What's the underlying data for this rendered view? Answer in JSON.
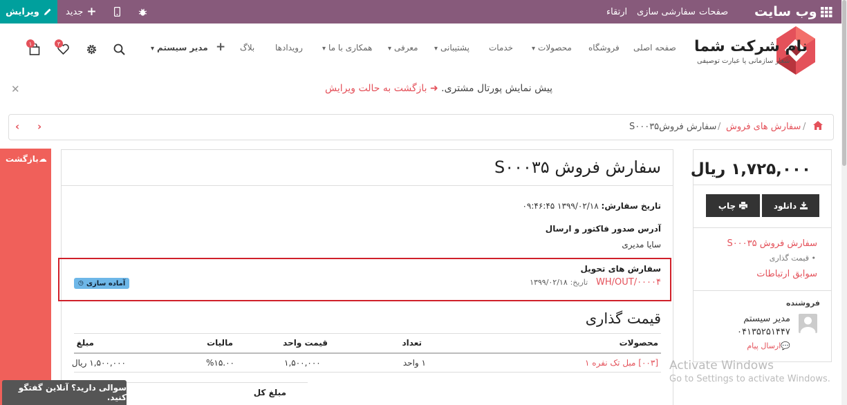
{
  "admin_bar": {
    "edit_label": "ویرایش",
    "new_label": "جدید",
    "site_title": "وب سایت",
    "pages": "صفحات",
    "customize": "سفارشی سازی",
    "upgrade": "ارتقاء"
  },
  "navbar": {
    "logo_name": "نام شرکت شما",
    "logo_slogan": "شعار سازمانی یا عبارت توصیفی",
    "links": [
      "صفحه اصلی",
      "فروشگاه",
      "محصولات",
      "خدمات",
      "پشتیبانی",
      "معرفی",
      "همکاری با ما",
      "رویدادها",
      "بلاگ"
    ],
    "user_menu": "مدیر سیستم",
    "wishlist_count": "۳",
    "cart_count": "۱"
  },
  "preview_banner": {
    "text": "پیش نمایش پورتال مشتری.",
    "link": "بازگشت به حالت ویرایش"
  },
  "breadcrumb": {
    "items": [
      "سفارش های فروش",
      "سفارش فروشS۰۰۰۳۵"
    ]
  },
  "back_panel": {
    "label": "بازگشت"
  },
  "order": {
    "title": "سفارش فروش S۰۰۰۳۵",
    "date_label": "تاریخ سفارش:",
    "date_value": "۱۳۹۹/۰۲/۱۸ ۰۹:۴۶:۴۵",
    "address_label": "آدرس صدور فاکتور و ارسال",
    "customer": "سایا مدیری",
    "delivery_title": "سفارش های تحویل",
    "delivery_ref": "WH/OUT/۰۰۰۰۴",
    "delivery_date_label": "تاریخ:",
    "delivery_date": "۱۳۹۹/۰۲/۱۸",
    "delivery_status": "آماده سازی",
    "pricing_title": "قیمت گذاری",
    "table": {
      "headers": [
        "محصولات",
        "تعداد",
        "قیمت واحد",
        "مالیات",
        "مبلغ"
      ],
      "rows": [
        [
          "[۰۰۳] مبل تک نفره ۱",
          "۱ واحد",
          "۱,۵۰۰,۰۰۰",
          "%۱۵.۰۰",
          "۱,۵۰۰,۰۰۰ ریال"
        ]
      ]
    },
    "total_label": "مبلغ کل"
  },
  "sidebar": {
    "amount": "۱,۷۲۵,۰۰۰ ریال",
    "download": "دانلود",
    "print": "چاپ",
    "order_link": "سفارش فروش S۰۰۰۳۵",
    "order_sub": "قیمت گذاری",
    "history_link": "سوابق ارتباطات",
    "salesperson_label": "فروشنده",
    "salesperson_name": "مدیر سیستم",
    "salesperson_phone": "۰۴۱۳۵۲۵۱۴۴۷",
    "send_message": "ارسال پیام"
  },
  "chat": {
    "label": "سوالی دارید؟ آنلاین گفتگو کنید."
  },
  "watermark": {
    "line1": "Activate Windows",
    "line2": "Go to Settings to activate Windows."
  }
}
